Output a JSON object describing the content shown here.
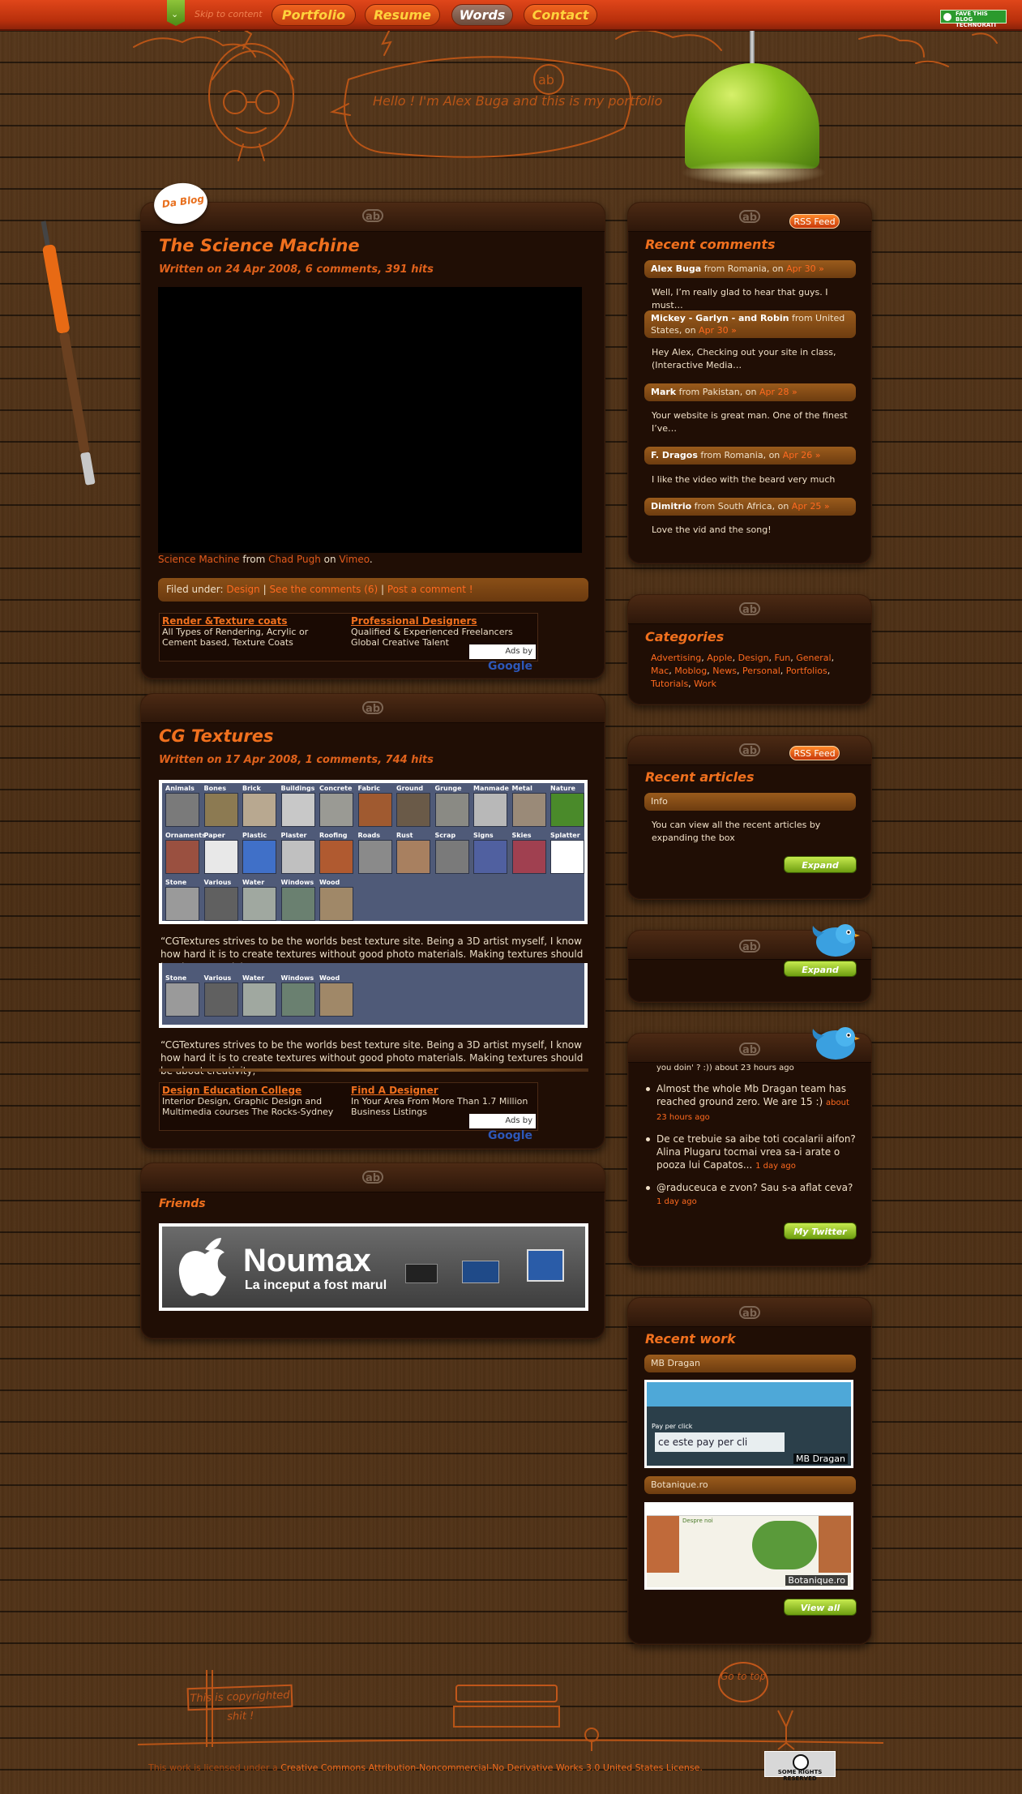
{
  "nav": {
    "skip": "Skip to content",
    "items": [
      "Portfolio",
      "Resume",
      "Words",
      "Contact"
    ],
    "technorati": "FAVE THIS BLOG TECHNORATI"
  },
  "header": {
    "speech": "Hello ! I'm Alex Buga and this is my portfolio",
    "ab": "ab"
  },
  "blog_badge": "Da Blog",
  "posts": [
    {
      "title": "The Science Machine",
      "meta": "Written on 24 Apr 2008, 6 comments, 391 hits",
      "credit_link": "Science Machine",
      "credit_from": "from",
      "credit_author": "Chad Pugh",
      "credit_on": "on",
      "credit_site": "Vimeo",
      "filed_label": "Filed under:",
      "filed_cat": "Design",
      "filed_comments": "See the comments (6)",
      "filed_post": "Post a comment !",
      "ads": [
        {
          "title": "Render &Texture coats",
          "text": "All Types of Rendering, Acrylic or Cement based, Texture Coats"
        },
        {
          "title": "Professional Designers",
          "text": "Qualified & Experienced Freelancers Global Creative Talent"
        }
      ]
    },
    {
      "title": "CG Textures",
      "meta": "Written on 17 Apr 2008, 1 comments, 744 hits",
      "quote": "“CGTextures strives to be the worlds best texture site. Being a 3D artist myself, I know how hard it is to create textures without good photo materials. Making textures should be about creativity,",
      "ads": [
        {
          "title": "Design Education College",
          "text": "Interior Design, Graphic Design and Multimedia courses The Rocks-Sydney"
        },
        {
          "title": "Find A Designer",
          "text": "In Your Area From More Than 1.7 Million Business Listings"
        }
      ]
    }
  ],
  "ads_by": "Ads by",
  "google": "Google",
  "cg_categories": [
    [
      "Animals",
      "Bones",
      "Brick",
      "Buildings",
      "Concrete",
      "Fabric",
      "Ground",
      "Grunge",
      "Manmade",
      "Metal",
      "Nature"
    ],
    [
      "Ornaments",
      "Paper",
      "Plastic",
      "Plaster",
      "Roofing",
      "Roads",
      "Rust",
      "Scrap",
      "Signs",
      "Skies",
      "Splatter"
    ],
    [
      "Stone",
      "Various",
      "Water",
      "Windows",
      "Wood"
    ]
  ],
  "friends": {
    "title": "Friends",
    "brand": "Noumax",
    "tagline": "La inceput a fost marul"
  },
  "sidebar": {
    "rss": "RSS Feed",
    "recent_comments_title": "Recent comments",
    "comments": [
      {
        "name": "Alex Buga",
        "from": "from Romania, on",
        "date": "Apr 30 »",
        "text": "Well, I’m really glad to hear that guys. I must…"
      },
      {
        "name": "Mickey - Garlyn - and Robin",
        "from": "from United States, on",
        "date": "Apr 30 »",
        "text": "Hey Alex, Checking out your site in class, (Interactive Media…"
      },
      {
        "name": "Mark",
        "from": "from Pakistan, on",
        "date": "Apr 28 »",
        "text": "Your website is great man. One of the finest I’ve…"
      },
      {
        "name": "F. Dragos",
        "from": "from Romania, on",
        "date": "Apr 26 »",
        "text": "I like the video with the beard very much"
      },
      {
        "name": "Dimitrio",
        "from": "from South Africa, on",
        "date": "Apr 25 »",
        "text": "Love the vid and the song!"
      }
    ],
    "categories_title": "Categories",
    "categories": [
      "Advertising",
      "Apple",
      "Design",
      "Fun",
      "General",
      "Mac",
      "Moblog",
      "News",
      "Personal",
      "Portfolios",
      "Tutorials",
      "Work"
    ],
    "recent_articles_title": "Recent articles",
    "info_label": "Info",
    "info_text": "You can view all the recent articles by expanding the box",
    "expand": "Expand",
    "tweet_partial": "you doin' ? :)) about 23 hours ago",
    "tweets": [
      {
        "text": "Almost the whole Mb Dragan team has reached ground zero. We are 15 :)",
        "when": "about 23 hours ago"
      },
      {
        "text": "De ce trebuie sa aibe toti cocalarii aifon? Alina Plugaru tocmai vrea sa-i arate o pooza lui Capatos...",
        "when": "1 day ago"
      },
      {
        "text": "@raduceuca e zvon? Sau s-a aflat ceva?",
        "when": "1 day ago"
      }
    ],
    "my_twitter": "My Twitter",
    "recent_work_title": "Recent work",
    "work": [
      {
        "label": "MB Dragan",
        "caption": "MB Dragan",
        "snip_a": "Pay per click",
        "snip_b": "ce este pay per cli"
      },
      {
        "label": "Botanique.ro",
        "caption": "Botanique.ro",
        "snip_a": "Despre noi",
        "snip_b": ""
      }
    ],
    "view_all": "View all"
  },
  "footer": {
    "sign": "This is copyrighted shit !",
    "goto": "Go to top",
    "license_prefix": "This work is licensed under a",
    "license_link": "Creative Commons Attribution-Noncommercial-No Derivative Works 3.0 United States License.",
    "cc_badge": "SOME RIGHTS RESERVED"
  },
  "colors": {
    "accent": "#f0701e",
    "nav": "#d03a12",
    "panel": "#200e05",
    "green": "#8cc21e"
  }
}
